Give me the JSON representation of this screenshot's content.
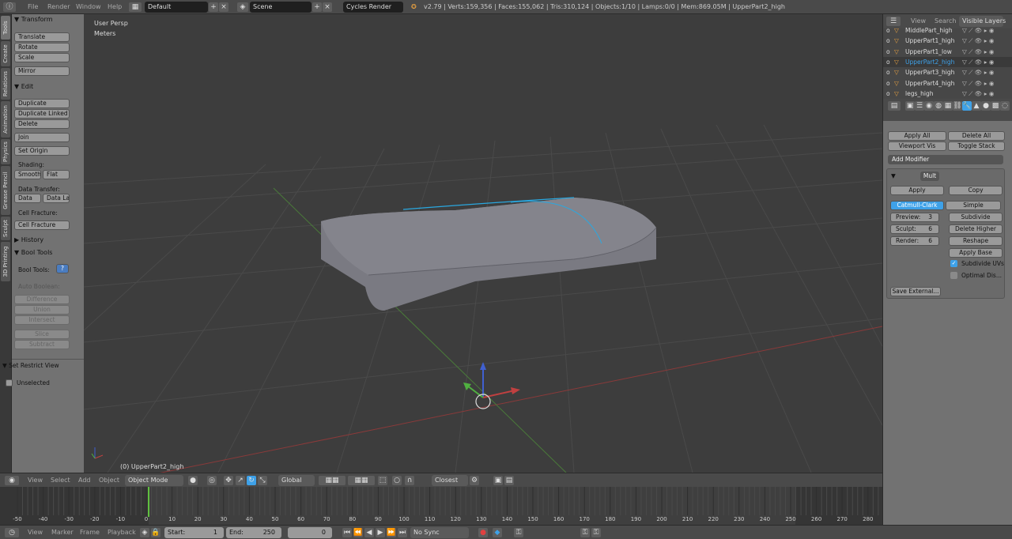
{
  "top": {
    "menus": [
      "File",
      "Render",
      "Window",
      "Help"
    ],
    "layout": "Default",
    "scene": "Scene",
    "engine": "Cycles Render",
    "stats": "v2.79 | Verts:159,356 | Faces:155,062 | Tris:310,124 | Objects:1/10 | Lamps:0/0 | Mem:869.05M | UpperPart2_high"
  },
  "tabs": [
    "Tools",
    "Create",
    "Relations",
    "Animation",
    "Physics",
    "Grease Pencil",
    "Sculpt",
    "3D Printing"
  ],
  "tool": {
    "transform": "Transform",
    "translate": "Translate",
    "rotate": "Rotate",
    "scale": "Scale",
    "mirror": "Mirror",
    "edit": "Edit",
    "duplicate": "Duplicate",
    "duplicate_linked": "Duplicate Linked",
    "delete": "Delete",
    "join": "Join",
    "set_origin": "Set Origin",
    "shading": "Shading:",
    "smooth": "Smooth",
    "flat": "Flat",
    "data_transfer": "Data Transfer:",
    "data": "Data",
    "data_la": "Data La",
    "cell_fracture_lbl": "Cell Fracture:",
    "cell_fracture": "Cell Fracture",
    "history": "History",
    "bool_tools_hdr": "Bool Tools",
    "bool_tools_lbl": "Bool Tools:",
    "help_btn": "?",
    "auto_boolean": "Auto Boolean:",
    "difference": "Difference",
    "union": "Union",
    "intersect": "Intersect",
    "slice": "Slice",
    "subtract": "Subtract",
    "brush_boolean": "Brush Boolean",
    "restrict_view": "Set Restrict View",
    "unselected": "Unselected"
  },
  "viewport": {
    "persp": "User Persp",
    "units": "Meters",
    "object_label": "(0) UpperPart2_high",
    "colors": {
      "x_axis": "#c04040",
      "y_axis": "#5aa040",
      "z_axis": "#4060d0",
      "highlight": "#2aa8e0"
    }
  },
  "vheader": {
    "menus": [
      "View",
      "Select",
      "Add",
      "Object"
    ],
    "mode": "Object Mode",
    "orientation": "Global",
    "snap": "Closest"
  },
  "timeline": {
    "ticks": [
      "-50",
      "-40",
      "-30",
      "-20",
      "-10",
      "0",
      "10",
      "20",
      "30",
      "40",
      "50",
      "60",
      "70",
      "80",
      "90",
      "100",
      "110",
      "120",
      "130",
      "140",
      "150",
      "160",
      "170",
      "180",
      "190",
      "200",
      "210",
      "220",
      "230",
      "240",
      "250",
      "260",
      "270",
      "280"
    ],
    "current_frame": "0"
  },
  "tlheader": {
    "menus": [
      "View",
      "Marker",
      "Frame",
      "Playback"
    ],
    "start_label": "Start:",
    "start": "1",
    "end_label": "End:",
    "end": "250",
    "frame": "0",
    "sync": "No Sync"
  },
  "outliner": {
    "tabs": [
      "View",
      "Search",
      "Visible Layers"
    ],
    "items": [
      "MiddlePart_high",
      "UpperPart1_high",
      "UpperPart1_low",
      "UpperPart2_high",
      "UpperPart3_high",
      "UpperPart4_high",
      "legs_high"
    ],
    "selected": "UpperPart2_high"
  },
  "props": {
    "apply_all": "Apply All",
    "delete_all": "Delete All",
    "viewport_vis": "Viewport Vis",
    "toggle_stack": "Toggle Stack",
    "add_modifier": "Add Modifier",
    "mod_name": "Mult",
    "apply": "Apply",
    "copy": "Copy",
    "catmull": "Catmull-Clark",
    "simple": "Simple",
    "preview_lbl": "Preview:",
    "preview": "3",
    "sculpt_lbl": "Sculpt:",
    "sculpt": "6",
    "render_lbl": "Render:",
    "render": "6",
    "subdivide": "Subdivide",
    "delete_higher": "Delete Higher",
    "reshape": "Reshape",
    "apply_base": "Apply Base",
    "subdivide_uvs": "Subdivide UVs",
    "optimal": "Optimal Dis...",
    "save_external": "Save External..."
  }
}
